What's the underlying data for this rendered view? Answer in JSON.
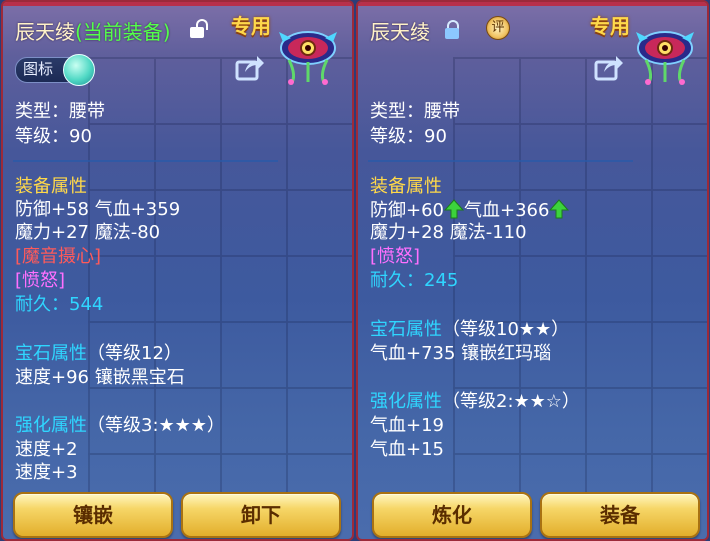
{
  "left": {
    "title_name": "辰天绫",
    "title_current": "(当前装备)",
    "lock_state": "unlocked",
    "badge": "专用",
    "toggle_label": "图标",
    "type_line": "类型：腰带",
    "level_line": "等级：90",
    "section_attr": "装备属性",
    "attr_line1": "防御+58 气血+359",
    "attr_line2": "魔力+27 魔法-80",
    "special_skill": "[魔音摄心]",
    "special_effect": "[愤怒]",
    "durability_label": "耐久：",
    "durability_value": "544",
    "section_gem": "宝石属性",
    "gem_level": "（等级12）",
    "gem_line": "速度+96 镶嵌黑宝石",
    "section_enhance": "强化属性",
    "enhance_level": "（等级3:★★★）",
    "enhance_line1": "速度+2",
    "enhance_line2": "速度+3",
    "buttons": [
      "镶嵌",
      "卸下"
    ]
  },
  "right": {
    "title_name": "辰天绫",
    "lock_state": "locked",
    "ping_badge": "评",
    "badge": "专用",
    "type_line": "类型：腰带",
    "level_line": "等级：90",
    "section_attr": "装备属性",
    "attr_def": "防御+60",
    "attr_hp": "气血+366",
    "attr_line2": "魔力+28 魔法-110",
    "special_effect": "[愤怒]",
    "durability_label": "耐久：",
    "durability_value": "245",
    "section_gem": "宝石属性",
    "gem_level": "（等级10★★）",
    "gem_line": "气血+735 镶嵌红玛瑙",
    "section_enhance": "强化属性",
    "enhance_level": "（等级2:★★☆）",
    "enhance_line1": "气血+19",
    "enhance_line2": "气血+15",
    "buttons": [
      "炼化",
      "装备"
    ]
  },
  "colors": {
    "title": "#fff2c8",
    "current_equip": "#54ff4a",
    "section_heading": "#ffd94a",
    "durability": "#2fd6ff",
    "skill_red": "#ff5a5a",
    "effect_purple": "#ff70ff",
    "increase_arrow": "#3cd33c",
    "button_gold": "#f6d667"
  },
  "icons": {
    "item": "demon-mask-belt-icon",
    "share": "share-icon",
    "lock_open": "unlocked-icon",
    "lock_closed": "locked-icon",
    "stat_up": "arrow-up-icon"
  }
}
